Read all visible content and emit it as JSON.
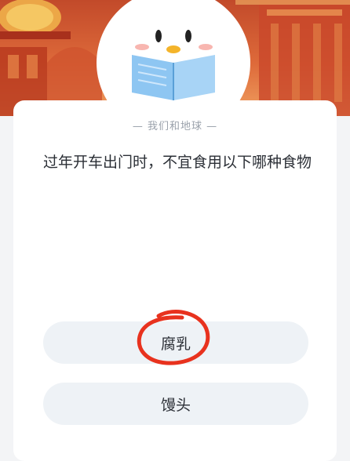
{
  "header": {
    "category_label": "我们和地球",
    "accent_color": "#d2553a",
    "mascot_icon": "penguin-reading-book-icon"
  },
  "quiz": {
    "question": "过年开车出门时，不宜食用以下哪种食物",
    "options": [
      {
        "label": "腐乳",
        "annotated": true
      },
      {
        "label": "馒头",
        "annotated": false
      }
    ],
    "annotation_color": "#e8321e"
  }
}
